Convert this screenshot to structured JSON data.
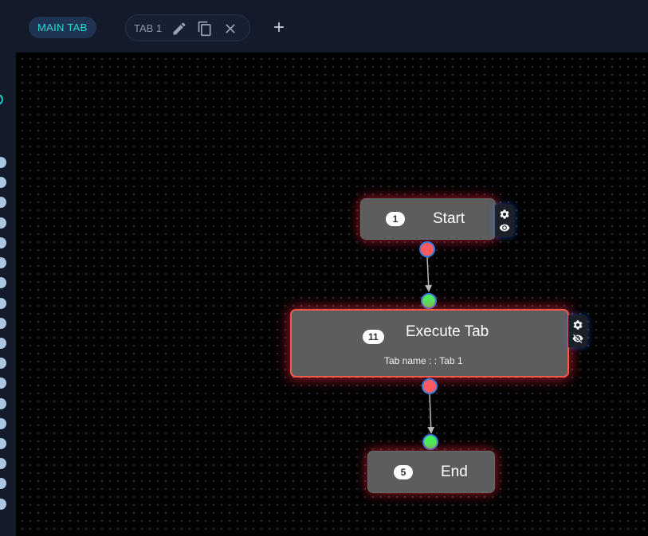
{
  "tabs": {
    "main_tab": "MAIN TAB",
    "tab1_label": "TAB 1",
    "icons": [
      "edit-icon",
      "copy-icon",
      "close-icon",
      "plus-icon"
    ]
  },
  "nodes": {
    "start": {
      "badge": "1",
      "title": "Start"
    },
    "execute": {
      "badge": "11",
      "title": "Execute Tab",
      "subtitle": "Tab name : : Tab 1"
    },
    "end": {
      "badge": "5",
      "title": "End"
    }
  },
  "colors": {
    "accent_teal": "#31d6d6",
    "port_out": "#ff5a5f",
    "port_in": "#47f25a",
    "selected_border": "#f25a4a"
  }
}
